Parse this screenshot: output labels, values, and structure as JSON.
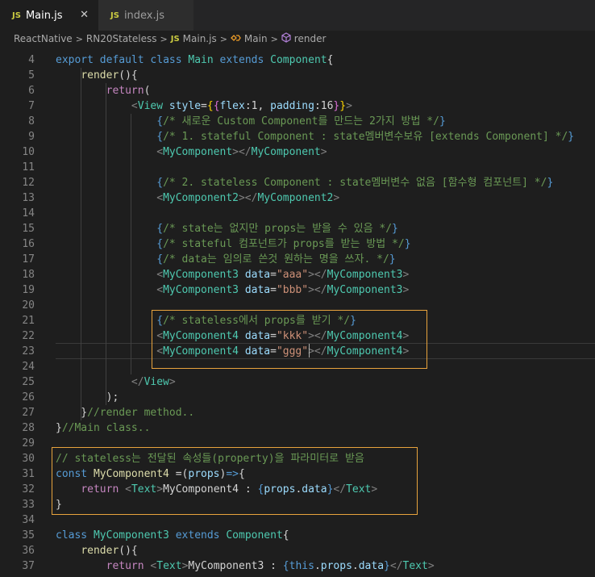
{
  "tabs": [
    {
      "badge": "JS",
      "label": "Main.js",
      "close": "✕"
    },
    {
      "badge": "JS",
      "label": "index.js"
    }
  ],
  "breadcrumb": {
    "items": [
      "ReactNative",
      "RN20Stateless",
      "Main.js",
      "Main",
      "render"
    ],
    "js_badge": "JS",
    "separator": ">"
  },
  "editor": {
    "line_numbers": [
      "4",
      "5",
      "6",
      "7",
      "8",
      "9",
      "10",
      "11",
      "12",
      "13",
      "14",
      "15",
      "16",
      "17",
      "18",
      "19",
      "20",
      "21",
      "22",
      "23",
      "24",
      "25",
      "26",
      "27",
      "28",
      "29",
      "30",
      "31",
      "32",
      "33",
      "34",
      "35",
      "36",
      "37"
    ],
    "lines": [
      [
        [
          "k",
          "export "
        ],
        [
          "k",
          "default "
        ],
        [
          "k",
          "class "
        ],
        [
          "t",
          "Main "
        ],
        [
          "k",
          "extends "
        ],
        [
          "t",
          "Component"
        ],
        [
          "p",
          "{"
        ]
      ],
      [
        [
          "p",
          "    "
        ],
        [
          "f",
          "render"
        ],
        [
          "p",
          "(){"
        ]
      ],
      [
        [
          "p",
          "        "
        ],
        [
          "kc",
          "return"
        ],
        [
          "p",
          "("
        ]
      ],
      [
        [
          "p",
          "            "
        ],
        [
          "g",
          "<"
        ],
        [
          "t",
          "View "
        ],
        [
          "v",
          "style"
        ],
        [
          "p",
          "="
        ],
        [
          "br2",
          "{"
        ],
        [
          "br",
          "{"
        ],
        [
          "v",
          "flex"
        ],
        [
          "p",
          ":1, "
        ],
        [
          "v",
          "padding"
        ],
        [
          "p",
          ":16"
        ],
        [
          "br",
          "}"
        ],
        [
          "br2",
          "}"
        ],
        [
          "g",
          ">"
        ]
      ],
      [
        [
          "p",
          "                "
        ],
        [
          "k",
          "{"
        ],
        [
          "c",
          "/* 새로운 Custom Component를 만드는 2가지 방법 */"
        ],
        [
          "k",
          "}"
        ]
      ],
      [
        [
          "p",
          "                "
        ],
        [
          "k",
          "{"
        ],
        [
          "c",
          "/* 1. stateful Component : state멤버변수보유 [extends Component] */"
        ],
        [
          "k",
          "}"
        ]
      ],
      [
        [
          "p",
          "                "
        ],
        [
          "g",
          "<"
        ],
        [
          "t",
          "MyComponent"
        ],
        [
          "g",
          "></"
        ],
        [
          "t",
          "MyComponent"
        ],
        [
          "g",
          ">"
        ]
      ],
      [
        [
          "p",
          ""
        ]
      ],
      [
        [
          "p",
          "                "
        ],
        [
          "k",
          "{"
        ],
        [
          "c",
          "/* 2. stateless Component : state멤버변수 없음 [함수형 컴포넌트] */"
        ],
        [
          "k",
          "}"
        ]
      ],
      [
        [
          "p",
          "                "
        ],
        [
          "g",
          "<"
        ],
        [
          "t",
          "MyComponent2"
        ],
        [
          "g",
          "></"
        ],
        [
          "t",
          "MyComponent2"
        ],
        [
          "g",
          ">"
        ]
      ],
      [
        [
          "p",
          ""
        ]
      ],
      [
        [
          "p",
          "                "
        ],
        [
          "k",
          "{"
        ],
        [
          "c",
          "/* state는 없지만 props는 받을 수 있음 */"
        ],
        [
          "k",
          "}"
        ]
      ],
      [
        [
          "p",
          "                "
        ],
        [
          "k",
          "{"
        ],
        [
          "c",
          "/* stateful 컴포넌트가 props를 받는 방법 */"
        ],
        [
          "k",
          "}"
        ]
      ],
      [
        [
          "p",
          "                "
        ],
        [
          "k",
          "{"
        ],
        [
          "c",
          "/* data는 임의로 쓴것 원하는 명을 쓰자. */"
        ],
        [
          "k",
          "}"
        ]
      ],
      [
        [
          "p",
          "                "
        ],
        [
          "g",
          "<"
        ],
        [
          "t",
          "MyComponent3 "
        ],
        [
          "v",
          "data"
        ],
        [
          "p",
          "="
        ],
        [
          "s",
          "\"aaa\""
        ],
        [
          "g",
          "></"
        ],
        [
          "t",
          "MyComponent3"
        ],
        [
          "g",
          ">"
        ]
      ],
      [
        [
          "p",
          "                "
        ],
        [
          "g",
          "<"
        ],
        [
          "t",
          "MyComponent3 "
        ],
        [
          "v",
          "data"
        ],
        [
          "p",
          "="
        ],
        [
          "s",
          "\"bbb\""
        ],
        [
          "g",
          "></"
        ],
        [
          "t",
          "MyComponent3"
        ],
        [
          "g",
          ">"
        ]
      ],
      [
        [
          "p",
          ""
        ]
      ],
      [
        [
          "p",
          "                "
        ],
        [
          "k",
          "{"
        ],
        [
          "c",
          "/* stateless에서 props를 받기 */"
        ],
        [
          "k",
          "}"
        ]
      ],
      [
        [
          "p",
          "                "
        ],
        [
          "g",
          "<"
        ],
        [
          "t",
          "MyComponent4 "
        ],
        [
          "v",
          "data"
        ],
        [
          "p",
          "="
        ],
        [
          "s",
          "\"kkk\""
        ],
        [
          "g",
          "></"
        ],
        [
          "t",
          "MyComponent4"
        ],
        [
          "g",
          ">"
        ]
      ],
      [
        [
          "p",
          "                "
        ],
        [
          "g",
          "<"
        ],
        [
          "t",
          "MyComponent4 "
        ],
        [
          "v",
          "data"
        ],
        [
          "p",
          "="
        ],
        [
          "s",
          "\"ggg\""
        ],
        [
          "g",
          "></"
        ],
        [
          "t",
          "MyComponent4"
        ],
        [
          "g",
          ">"
        ]
      ],
      [
        [
          "p",
          ""
        ]
      ],
      [
        [
          "p",
          "            "
        ],
        [
          "g",
          "</"
        ],
        [
          "t",
          "View"
        ],
        [
          "g",
          ">"
        ]
      ],
      [
        [
          "p",
          "        );"
        ]
      ],
      [
        [
          "p",
          "    }"
        ],
        [
          "c",
          "//render method.."
        ]
      ],
      [
        [
          "p",
          "}"
        ],
        [
          "c",
          "//Main class.."
        ]
      ],
      [
        [
          "p",
          ""
        ]
      ],
      [
        [
          "c",
          "// stateless는 전달된 속성들(property)을 파라미터로 받음"
        ]
      ],
      [
        [
          "k",
          "const "
        ],
        [
          "f",
          "MyComponent4 "
        ],
        [
          "p",
          "="
        ],
        [
          "p",
          "("
        ],
        [
          "v",
          "props"
        ],
        [
          "p",
          ")"
        ],
        [
          "k",
          "=>"
        ],
        [
          "p",
          "{"
        ]
      ],
      [
        [
          "p",
          "    "
        ],
        [
          "kc",
          "return "
        ],
        [
          "g",
          "<"
        ],
        [
          "t",
          "Text"
        ],
        [
          "g",
          ">"
        ],
        [
          "p",
          "MyComponent4 : "
        ],
        [
          "k",
          "{"
        ],
        [
          "v",
          "props"
        ],
        [
          "p",
          "."
        ],
        [
          "v",
          "data"
        ],
        [
          "k",
          "}"
        ],
        [
          "g",
          "</"
        ],
        [
          "t",
          "Text"
        ],
        [
          "g",
          ">"
        ]
      ],
      [
        [
          "p",
          "}"
        ]
      ],
      [
        [
          "p",
          ""
        ]
      ],
      [
        [
          "k",
          "class "
        ],
        [
          "t",
          "MyComponent3 "
        ],
        [
          "k",
          "extends "
        ],
        [
          "t",
          "Component"
        ],
        [
          "p",
          "{"
        ]
      ],
      [
        [
          "p",
          "    "
        ],
        [
          "f",
          "render"
        ],
        [
          "p",
          "(){"
        ]
      ],
      [
        [
          "p",
          "        "
        ],
        [
          "kc",
          "return "
        ],
        [
          "g",
          "<"
        ],
        [
          "t",
          "Text"
        ],
        [
          "g",
          ">"
        ],
        [
          "p",
          "MyComponent3 : "
        ],
        [
          "k",
          "{"
        ],
        [
          "k",
          "this"
        ],
        [
          "p",
          "."
        ],
        [
          "v",
          "props"
        ],
        [
          "p",
          "."
        ],
        [
          "v",
          "data"
        ],
        [
          "k",
          "}"
        ],
        [
          "g",
          "</"
        ],
        [
          "t",
          "Text"
        ],
        [
          "g",
          ">"
        ]
      ]
    ]
  }
}
